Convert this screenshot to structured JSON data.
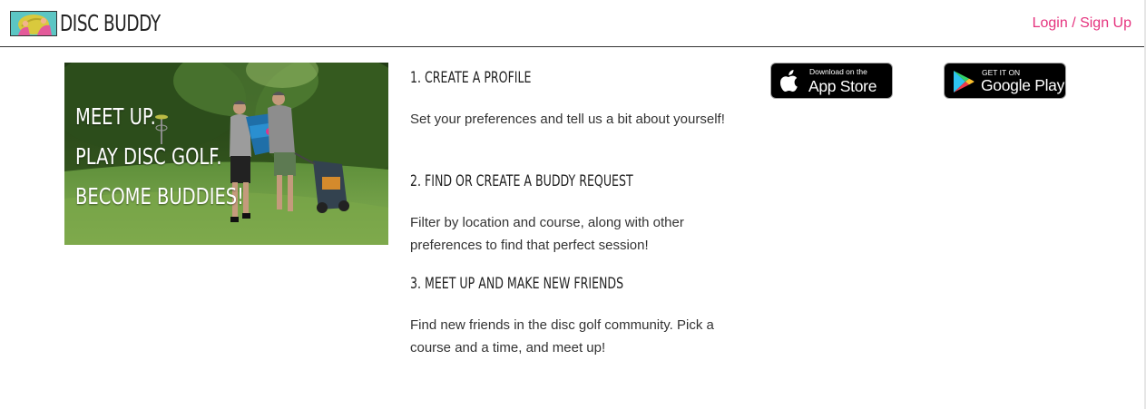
{
  "header": {
    "brand_name": "DISC BUDDY",
    "login_label": "Login / Sign Up"
  },
  "hero": {
    "lines": [
      "MEET UP.",
      "PLAY DISC GOLF.",
      "BECOME BUDDIES!"
    ]
  },
  "steps": [
    {
      "heading": "1. CREATE A PROFILE",
      "text": "Set your preferences and tell us a bit about yourself!"
    },
    {
      "heading": "2. FIND OR CREATE A BUDDY REQUEST",
      "text": "Filter by location and course, along with other preferences to find that perfect session!"
    },
    {
      "heading": "3. MEET UP AND MAKE NEW FRIENDS",
      "text": "Find new friends in the disc golf community. Pick a course and a time, and meet up!"
    }
  ],
  "badges": {
    "app_store": {
      "small": "Download on the",
      "big": "App Store"
    },
    "google_play": {
      "small": "GET IT ON",
      "big": "Google Play"
    }
  },
  "colors": {
    "accent": "#e5337e",
    "text": "#333333",
    "border": "#333333"
  }
}
